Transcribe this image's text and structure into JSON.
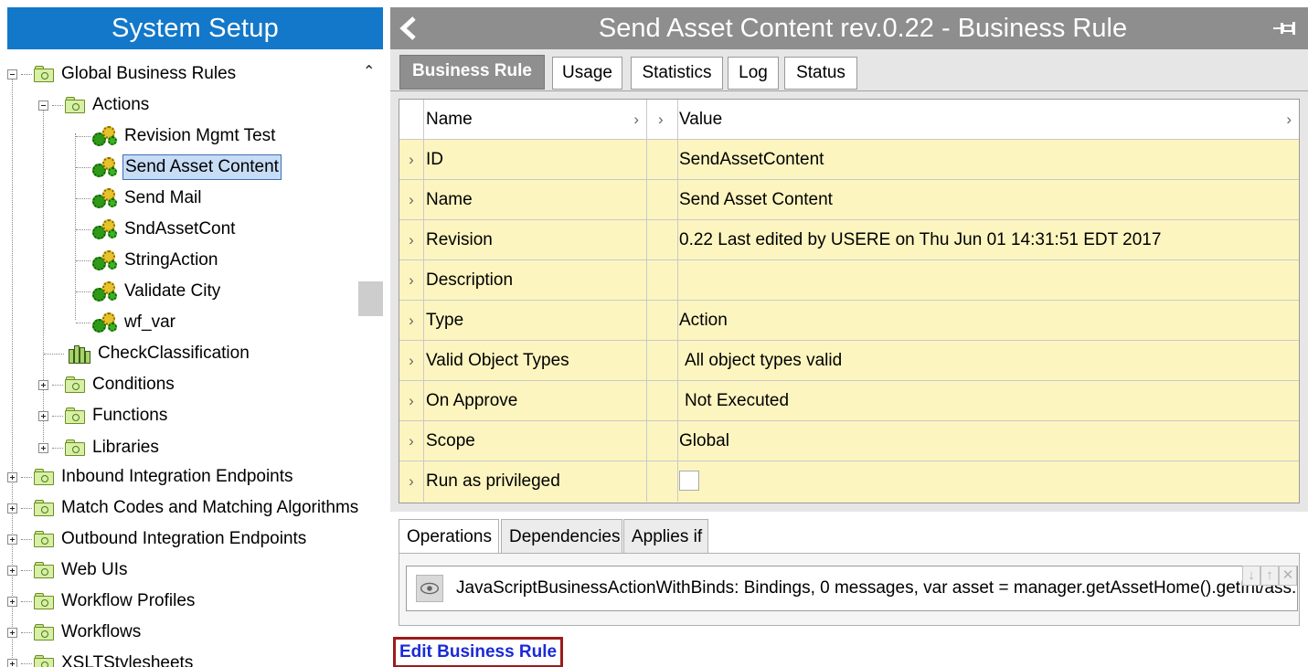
{
  "left_panel": {
    "title": "System Setup",
    "tree": [
      {
        "label": "Global Business Rules",
        "icon": "folder-icon",
        "expander": "minus"
      },
      {
        "label": "Actions",
        "icon": "folder-icon",
        "expander": "minus"
      },
      {
        "label": "Revision Mgmt Test",
        "icon": "action-gears-icon"
      },
      {
        "label": "Send Asset Content",
        "icon": "action-gears-icon",
        "selected": true
      },
      {
        "label": "Send Mail",
        "icon": "action-gears-icon"
      },
      {
        "label": "SndAssetCont",
        "icon": "action-gears-icon"
      },
      {
        "label": "StringAction",
        "icon": "action-gears-icon"
      },
      {
        "label": "Validate City",
        "icon": "action-gears-icon"
      },
      {
        "label": "wf_var",
        "icon": "action-gears-icon"
      },
      {
        "label": "CheckClassification",
        "icon": "library-books-icon"
      },
      {
        "label": "Conditions",
        "icon": "folder-icon",
        "expander": "plus"
      },
      {
        "label": "Functions",
        "icon": "folder-icon",
        "expander": "plus"
      },
      {
        "label": "Libraries",
        "icon": "folder-icon",
        "expander": "plus"
      },
      {
        "label": "Inbound Integration Endpoints",
        "icon": "folder-icon",
        "expander": "plus"
      },
      {
        "label": "Match Codes and Matching Algorithms",
        "icon": "folder-icon",
        "expander": "plus"
      },
      {
        "label": "Outbound Integration Endpoints",
        "icon": "folder-icon",
        "expander": "plus"
      },
      {
        "label": "Web UIs",
        "icon": "folder-icon",
        "expander": "plus"
      },
      {
        "label": "Workflow Profiles",
        "icon": "folder-icon",
        "expander": "plus"
      },
      {
        "label": "Workflows",
        "icon": "folder-icon",
        "expander": "plus"
      },
      {
        "label": "XSLTStylesheets",
        "icon": "folder-icon",
        "expander": "plus"
      }
    ]
  },
  "editor": {
    "title": "Send Asset Content rev.0.22 - Business Rule",
    "tabs": [
      "Business Rule",
      "Usage",
      "Statistics",
      "Log",
      "Status"
    ],
    "active_tab": "Business Rule",
    "table_header": {
      "name": "Name",
      "value": "Value"
    },
    "properties": [
      {
        "name": "ID",
        "value": "SendAssetContent"
      },
      {
        "name": "Name",
        "value": "Send Asset Content"
      },
      {
        "name": "Revision",
        "value": "0.22 Last edited by USERE on Thu Jun 01 14:31:51 EDT 2017"
      },
      {
        "name": "Description",
        "value": ""
      },
      {
        "name": "Type",
        "value": "Action"
      },
      {
        "name": "Valid Object Types",
        "value": "All object types valid"
      },
      {
        "name": "On Approve",
        "value": "Not Executed"
      },
      {
        "name": "Scope",
        "value": "Global"
      },
      {
        "name": "Run as privileged",
        "value": "",
        "checkbox": false
      }
    ],
    "bottom_tabs": [
      "Operations",
      "Dependencies",
      "Applies if"
    ],
    "active_bottom_tab": "Operations",
    "operation": "JavaScriptBusinessActionWithBinds: Bindings, 0 messages, var asset = manager.getAssetHome().getInt/ass...",
    "edit_link": "Edit Business Rule"
  },
  "colors": {
    "header_blue": "#1378c9",
    "titlebar_gray": "#8e8e8e",
    "property_yellow": "#fdf5c0",
    "link_blue": "#1a2ad6",
    "highlight_red": "#9b1c1c"
  }
}
